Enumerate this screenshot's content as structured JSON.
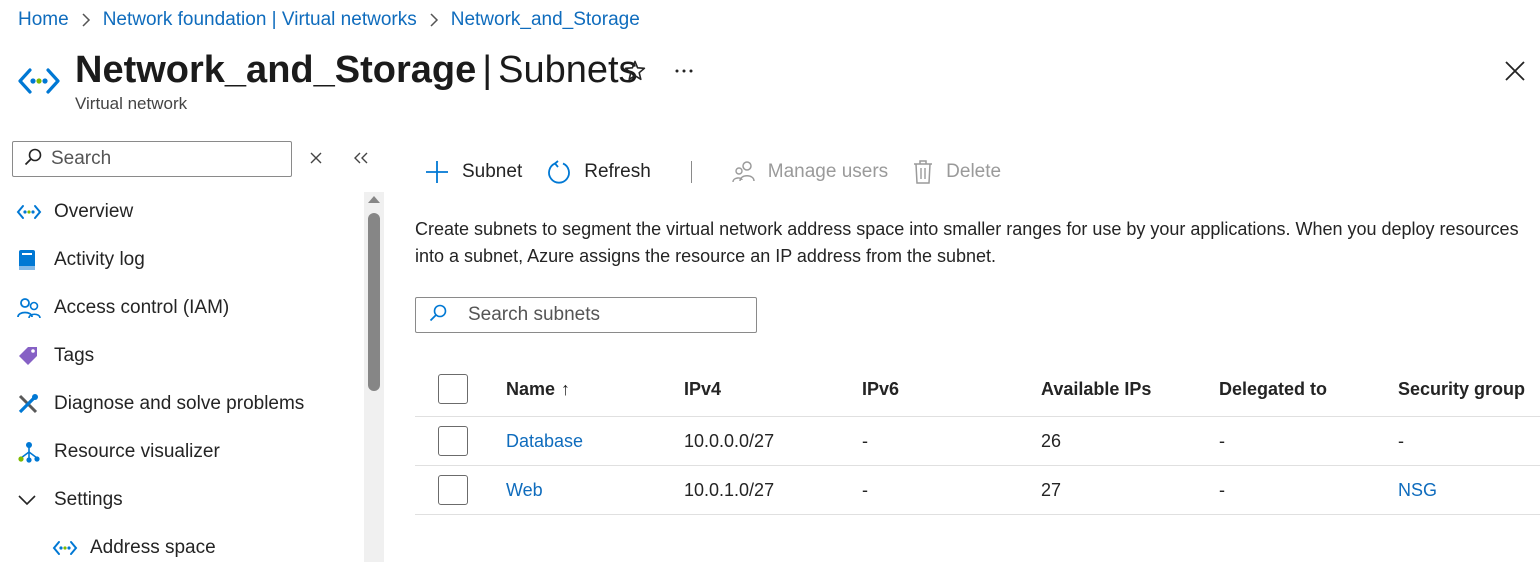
{
  "breadcrumb": {
    "items": [
      "Home",
      "Network foundation | Virtual networks",
      "Network_and_Storage"
    ]
  },
  "header": {
    "resource_name": "Network_and_Storage",
    "separator": "|",
    "blade_name": "Subnets",
    "subtitle": "Virtual network",
    "more_label": "···"
  },
  "sidebar": {
    "search_placeholder": "Search",
    "items": [
      {
        "label": "Overview",
        "icon": "vnet-icon"
      },
      {
        "label": "Activity log",
        "icon": "activity-log-icon"
      },
      {
        "label": "Access control (IAM)",
        "icon": "iam-icon"
      },
      {
        "label": "Tags",
        "icon": "tag-icon"
      },
      {
        "label": "Diagnose and solve problems",
        "icon": "wrench-icon"
      },
      {
        "label": "Resource visualizer",
        "icon": "visualizer-icon"
      },
      {
        "label": "Settings",
        "icon": "chevron-down-icon"
      },
      {
        "label": "Address space",
        "icon": "vnet-icon"
      }
    ]
  },
  "toolbar": {
    "add_subnet_label": "Subnet",
    "refresh_label": "Refresh",
    "manage_users_label": "Manage users",
    "delete_label": "Delete"
  },
  "description": "Create subnets to segment the virtual network address space into smaller ranges for use by your applications. When you deploy resources into a subnet, Azure assigns the resource an IP address from the subnet.",
  "subnet_search": {
    "placeholder": "Search subnets"
  },
  "table": {
    "columns": [
      "Name",
      "IPv4",
      "IPv6",
      "Available IPs",
      "Delegated to",
      "Security group"
    ],
    "sort_indicator": "↑",
    "rows": [
      {
        "name": "Database",
        "ipv4": "10.0.0.0/27",
        "ipv6": "-",
        "available_ips": "26",
        "delegated_to": "-",
        "security_group": "-"
      },
      {
        "name": "Web",
        "ipv4": "10.0.1.0/27",
        "ipv6": "-",
        "available_ips": "27",
        "delegated_to": "-",
        "security_group": "NSG"
      }
    ]
  },
  "colors": {
    "link": "#0f6cbd",
    "accent_green": "#7fba00",
    "accent_blue": "#0078d4",
    "disabled_text": "#9a9a9a"
  }
}
